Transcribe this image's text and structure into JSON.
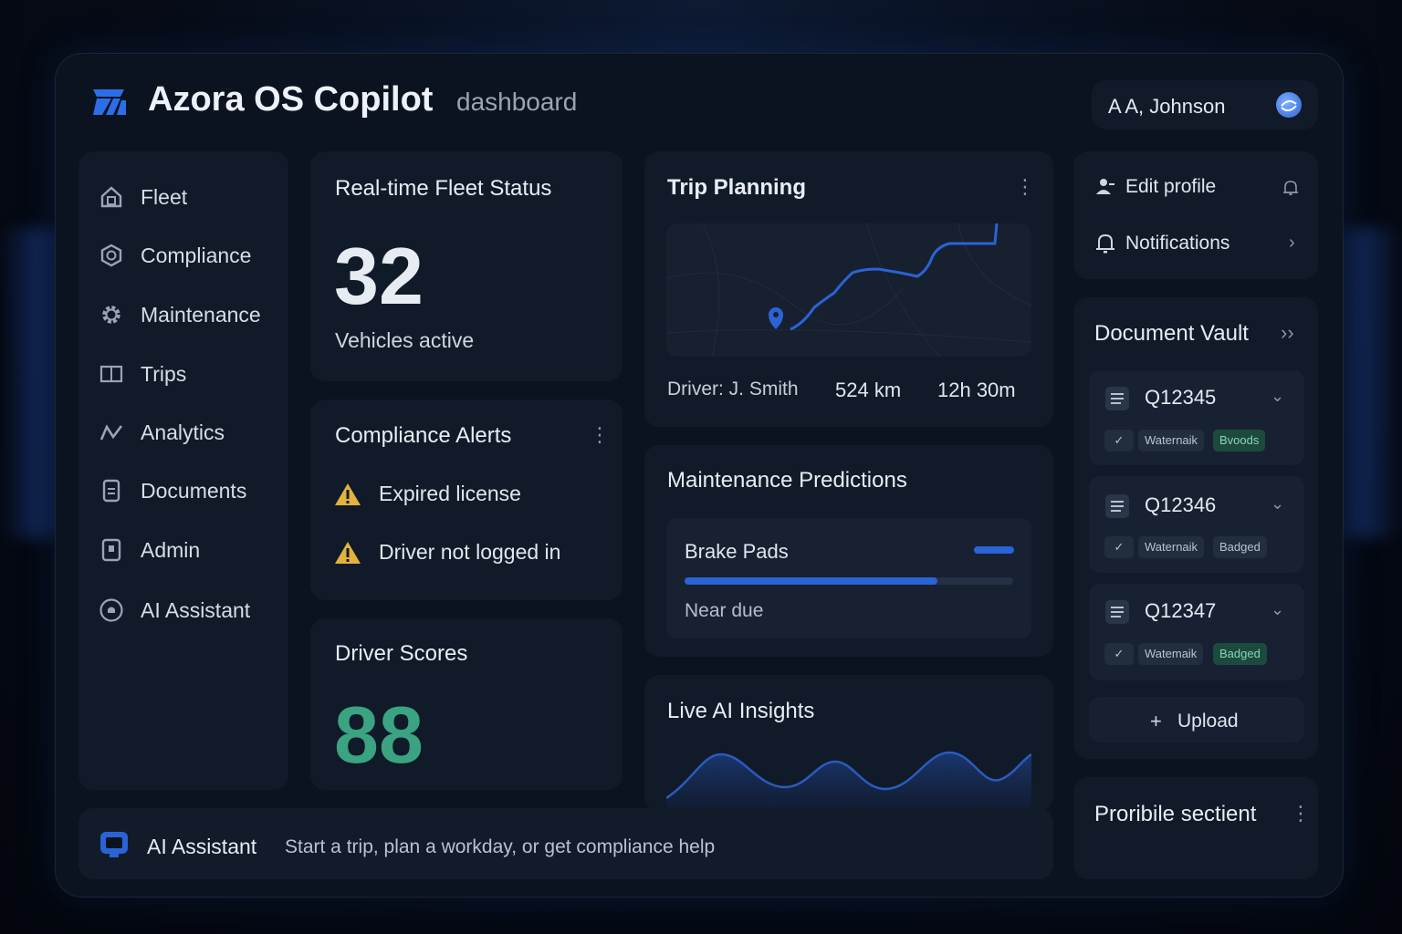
{
  "app": {
    "title": "Azora OS Copilot",
    "subtitle": "dashboard"
  },
  "user": {
    "name": "A A, Johnson"
  },
  "sidebar": {
    "items": [
      {
        "label": "Fleet",
        "icon": "home-icon"
      },
      {
        "label": "Compliance",
        "icon": "hexagon-icon"
      },
      {
        "label": "Maintenance",
        "icon": "gear-icon"
      },
      {
        "label": "Trips",
        "icon": "map-panel-icon"
      },
      {
        "label": "Analytics",
        "icon": "trend-icon"
      },
      {
        "label": "Documents",
        "icon": "document-icon"
      },
      {
        "label": "Admin",
        "icon": "admin-icon"
      },
      {
        "label": "AI Assistant",
        "icon": "assistant-icon"
      }
    ]
  },
  "fleet_status": {
    "title": "Real-time Fleet Status",
    "value": "32",
    "caption": "Vehicles active"
  },
  "compliance_alerts": {
    "title": "Compliance Alerts",
    "items": [
      {
        "label": "Expired license"
      },
      {
        "label": "Driver not logged in"
      }
    ]
  },
  "driver_scores": {
    "title": "Driver Scores",
    "value": "88"
  },
  "trip_planning": {
    "title": "Trip Planning",
    "driver": "Driver: J. Smith",
    "distance": "524 km",
    "duration": "12h 30m"
  },
  "maintenance": {
    "title": "Maintenance Predictions",
    "item": "Brake Pads",
    "status": "Near due",
    "progress": 0.77
  },
  "insights": {
    "title": "Live AI Insights"
  },
  "profile_menu": {
    "edit_profile": "Edit profile",
    "notifications": "Notifications"
  },
  "vault": {
    "title": "Document Vault",
    "docs": [
      {
        "id": "Q12345",
        "tag1": "Waternaik",
        "tag2": "Bvoods",
        "tag2_style": "green"
      },
      {
        "id": "Q12346",
        "tag1": "Waternaik",
        "tag2": "Badged",
        "tag2_style": "gray"
      },
      {
        "id": "Q12347",
        "tag1": "Watemaik",
        "tag2": "Badged",
        "tag2_style": "green"
      }
    ],
    "upload_label": "Upload"
  },
  "extra_section": {
    "title": "Proribile sectient"
  },
  "assistant_bar": {
    "title": "AI Assistant",
    "prompt": "Start a trip, plan a workday, or get compliance help"
  },
  "colors": {
    "accent": "#2a63d6",
    "green_score": "#3aa381",
    "warning": "#e3b23c",
    "background": "#0b1220"
  }
}
